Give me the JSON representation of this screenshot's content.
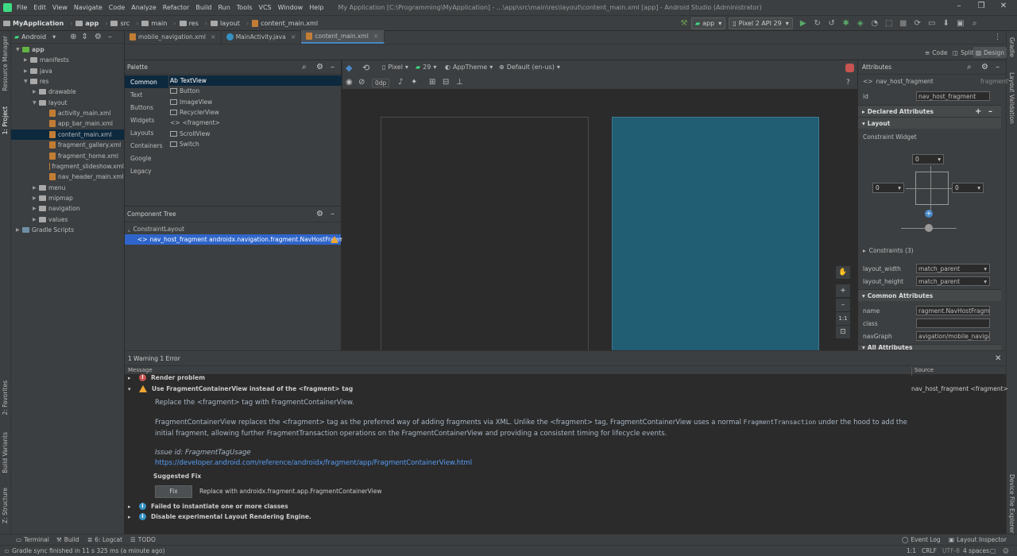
{
  "menu": [
    "File",
    "Edit",
    "View",
    "Navigate",
    "Code",
    "Analyze",
    "Refactor",
    "Build",
    "Run",
    "Tools",
    "VCS",
    "Window",
    "Help"
  ],
  "window_title": "My Application [C:\\Programming\\MyApplication] - ...\\app\\src\\main\\res\\layout\\content_main.xml [app] - Android Studio (Administrator)",
  "breadcrumbs": [
    "MyApplication",
    "app",
    "src",
    "main",
    "res",
    "layout",
    "content_main.xml"
  ],
  "run_config": "app",
  "device": "Pixel 2 API 29",
  "project": {
    "view_mode": "Android",
    "tree": [
      {
        "label": "app",
        "level": 0,
        "type": "module",
        "open": true
      },
      {
        "label": "manifests",
        "level": 1,
        "type": "folder",
        "open": false
      },
      {
        "label": "java",
        "level": 1,
        "type": "folder",
        "open": false
      },
      {
        "label": "res",
        "level": 1,
        "type": "folder",
        "open": true
      },
      {
        "label": "drawable",
        "level": 2,
        "type": "folder",
        "open": false
      },
      {
        "label": "layout",
        "level": 2,
        "type": "folder",
        "open": true
      },
      {
        "label": "activity_main.xml",
        "level": 3,
        "type": "xml"
      },
      {
        "label": "app_bar_main.xml",
        "level": 3,
        "type": "xml"
      },
      {
        "label": "content_main.xml",
        "level": 3,
        "type": "xml",
        "selected": true
      },
      {
        "label": "fragment_gallery.xml",
        "level": 3,
        "type": "xml"
      },
      {
        "label": "fragment_home.xml",
        "level": 3,
        "type": "xml"
      },
      {
        "label": "fragment_slideshow.xml",
        "level": 3,
        "type": "xml"
      },
      {
        "label": "nav_header_main.xml",
        "level": 3,
        "type": "xml"
      },
      {
        "label": "menu",
        "level": 2,
        "type": "folder",
        "open": false
      },
      {
        "label": "mipmap",
        "level": 2,
        "type": "folder",
        "open": false
      },
      {
        "label": "navigation",
        "level": 2,
        "type": "folder",
        "open": false
      },
      {
        "label": "values",
        "level": 2,
        "type": "folder",
        "open": false
      },
      {
        "label": "Gradle Scripts",
        "level": 0,
        "type": "gradle",
        "open": false
      }
    ]
  },
  "editor_tabs": [
    {
      "label": "mobile_navigation.xml",
      "active": false
    },
    {
      "label": "MainActivity.java",
      "active": false
    },
    {
      "label": "content_main.xml",
      "active": true
    }
  ],
  "modes": {
    "code": "Code",
    "split": "Split",
    "design": "Design"
  },
  "left_stripe": {
    "resource_manager": "Resource Manager",
    "project": "1: Project",
    "favorites": "2: Favorites",
    "build_variants": "Build Variants",
    "structure": "Z: Structure"
  },
  "right_stripe": {
    "gradle": "Gradle",
    "layout_validation": "Layout Validation",
    "device_file_explorer": "Device File Explorer"
  },
  "palette": {
    "title": "Palette",
    "categories": [
      "Common",
      "Text",
      "Buttons",
      "Widgets",
      "Layouts",
      "Containers",
      "Google",
      "Legacy"
    ],
    "items": [
      {
        "icon": "Ab",
        "label": "TextView"
      },
      {
        "icon": "",
        "label": "Button"
      },
      {
        "icon": "",
        "label": "ImageView"
      },
      {
        "icon": "",
        "label": "RecyclerView"
      },
      {
        "icon": "<>",
        "label": "<fragment>"
      },
      {
        "icon": "",
        "label": "ScrollView"
      },
      {
        "icon": "",
        "label": "Switch"
      }
    ]
  },
  "component_tree": {
    "title": "Component Tree",
    "root": "ConstraintLayout",
    "child": "nav_host_fragment  androidx.navigation.fragment.NavHostFragment"
  },
  "canvas_toolbar": {
    "device": "Pixel",
    "api": "29",
    "theme": "AppTheme",
    "locale": "Default (en-us)",
    "margin": "0dp"
  },
  "zoom": {
    "fit": "1:1"
  },
  "attributes": {
    "title": "Attributes",
    "component": "nav_host_fragment",
    "component_type": "fragment",
    "id_label": "id",
    "id_value": "nav_host_fragment",
    "declared": "Declared Attributes",
    "layout": "Layout",
    "constraint_widget": "Constraint Widget",
    "margins": {
      "top": "0",
      "left": "0",
      "right": "0"
    },
    "constraints": "Constraints (3)",
    "layout_width_label": "layout_width",
    "layout_width": "match_parent",
    "layout_height_label": "layout_height",
    "layout_height": "match_parent",
    "common": "Common Attributes",
    "name_label": "name",
    "name_value": "ragment.NavHostFragment",
    "class_label": "class",
    "class_value": "",
    "navgraph_label": "navGraph",
    "navgraph_value": "avigation/mobile_navigation",
    "all": "All Attributes"
  },
  "problems": {
    "summary": "1 Warning 1 Error",
    "col_message": "Message",
    "col_source": "Source",
    "render_problem": "Render problem",
    "warning_title": "Use FragmentContainerView instead of the <fragment> tag",
    "warning_source": "nav_host_fragment <fragment>",
    "line1": "Replace the <fragment> tag with FragmentContainerView.",
    "line2a": "FragmentContainerView replaces the <fragment> tag as the preferred way of adding fragments via XML. Unlike the <fragment> tag, FragmentContainerView uses a normal",
    "line2code": "FragmentTransaction",
    "line2b": "under the hood to add the",
    "line3": "initial fragment, allowing further FragmentTransaction operations on the FragmentContainerView and providing a consistent timing for lifecycle events.",
    "issue_id": "Issue id: FragmentTagUsage",
    "link": "https://developer.android.com/reference/androidx/fragment/app/FragmentContainerView.html",
    "suggested_fix": "Suggested Fix",
    "fix_button": "Fix",
    "fix_desc": "Replace with androidx.fragment.app.FragmentContainerView",
    "failed": "Failed to instantiate one or more classes",
    "disable": "Disable experimental Layout Rendering Engine."
  },
  "bottom_tools": [
    "Terminal",
    "Build",
    "6: Logcat",
    "TODO"
  ],
  "bottom_right_tools": [
    "Event Log",
    "Layout Inspector"
  ],
  "status": {
    "message": "Gradle sync finished in 11 s 325 ms (a minute ago)",
    "position": "1:1",
    "line_sep": "CRLF",
    "encoding": "UTF-8",
    "indent": "4 spaces"
  },
  "colors": {
    "accent": "#4a88c7",
    "selection": "#0d293e",
    "design_surface": "#215d73",
    "error": "#c75450",
    "warning": "#f0a732",
    "link": "#589df6"
  }
}
